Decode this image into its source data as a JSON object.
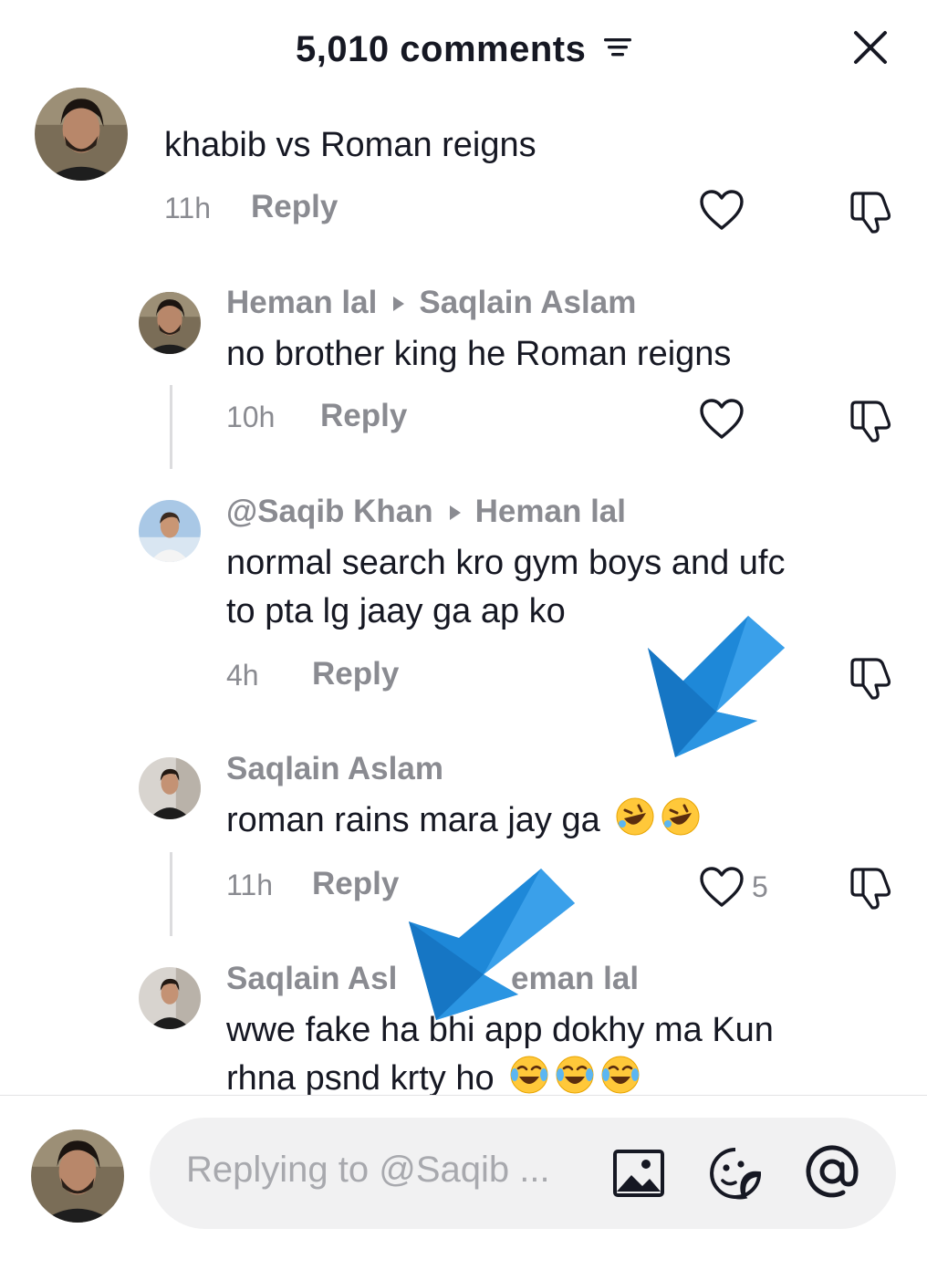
{
  "header": {
    "title": "5,010 comments",
    "sort_icon": "sort-lines-icon",
    "close_icon": "close-x-icon"
  },
  "comments": [
    {
      "text": "khabib vs Roman reigns",
      "time": "11h",
      "reply_label": "Reply",
      "avatar": "bearded-man-photo"
    },
    {
      "user": "Heman lal",
      "reply_to": "Saqlain Aslam",
      "text": "no brother king he Roman reigns",
      "time": "10h",
      "reply_label": "Reply",
      "avatar": "bearded-man-photo"
    },
    {
      "user": "@Saqib Khan",
      "reply_to": "Heman lal",
      "text_line1": "normal search kro gym boys and ufc",
      "text_line2": "to pta lg jaay ga ap ko",
      "time": "4h",
      "reply_label": "Reply",
      "avatar": "man-white-shirt-photo"
    },
    {
      "user": "Saqlain Aslam",
      "text": "roman rains mara jay ga",
      "emoji": [
        "rofl-emoji",
        "rofl-emoji"
      ],
      "time": "11h",
      "reply_label": "Reply",
      "like_count": "5",
      "avatar": "man-dark-suit-photo"
    },
    {
      "user": "Saqlain Asl",
      "user_tail": "eman lal",
      "text_line1": "wwe fake ha bhi app dokhy ma Kun",
      "text_line2": "rhna psnd krty ho",
      "emoji": [
        "tears-of-joy-emoji",
        "tears-of-joy-emoji",
        "tears-of-joy-emoji"
      ],
      "avatar": "man-dark-suit-photo"
    }
  ],
  "composer": {
    "placeholder": "Replying to @Saqib ...",
    "icons": [
      "image-icon",
      "sticker-icon",
      "mention-at-icon"
    ]
  },
  "colors": {
    "text": "#161823",
    "muted": "#8a8b91",
    "input_bg": "#f1f1f2",
    "arrow_blue": "#1e88d8"
  }
}
